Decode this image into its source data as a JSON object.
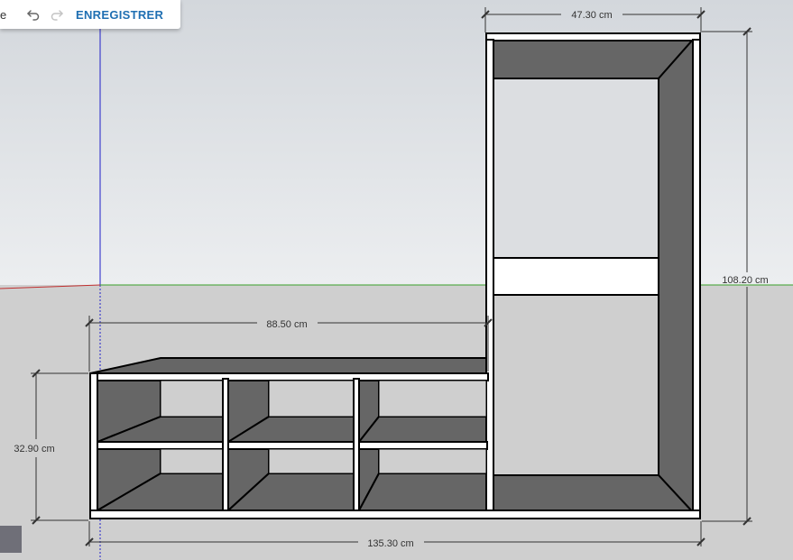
{
  "toolbar": {
    "menu_fragment": "e",
    "undo_icon": "undo-icon",
    "redo_icon": "redo-icon",
    "save_label": "ENREGISTRER"
  },
  "dimensions": {
    "tall_width": "47.30 cm",
    "total_height": "108.20 cm",
    "bench_width": "88.50 cm",
    "bench_height": "32.90 cm",
    "total_width": "135.30 cm"
  },
  "colors": {
    "sky_top": "#d6dadf",
    "sky_bottom": "#eef0f2",
    "ground": "#cfcfcf",
    "panel_dark": "#666666",
    "board": "#ffffff",
    "accent_blue": "#1f6fb2",
    "axis_green": "#3aa02a",
    "axis_blue": "#2020c8",
    "axis_red": "#c03030"
  }
}
